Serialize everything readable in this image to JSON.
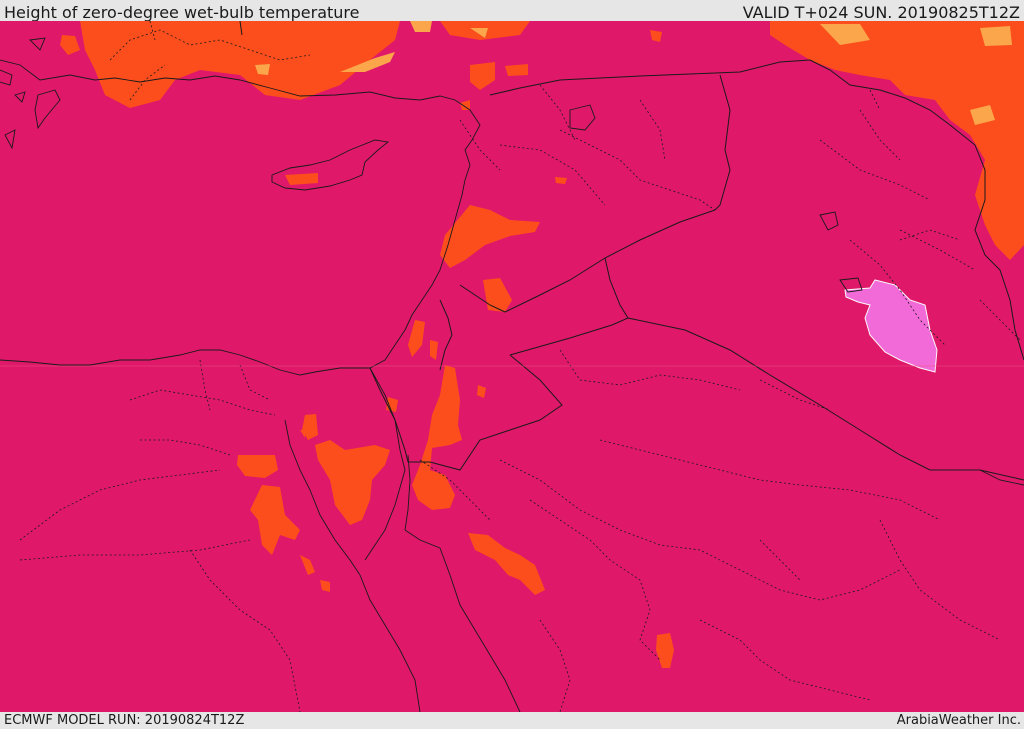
{
  "header": {
    "title": "Height of zero-degree wet-bulb temperature",
    "valid_time": "VALID T+024 SUN. 20190825T12Z"
  },
  "footer": {
    "model_run": "ECMWF MODEL RUN: 20190824T12Z",
    "credit": "ArabiaWeather Inc."
  },
  "map": {
    "colors": {
      "base_field": "#e0186a",
      "orange_band": "#fc4e1c",
      "light_orange_band": "#fba64a",
      "pink_band": "#f26ad8",
      "coastline": "#1a1a1a",
      "border": "#1a1a1a"
    }
  }
}
